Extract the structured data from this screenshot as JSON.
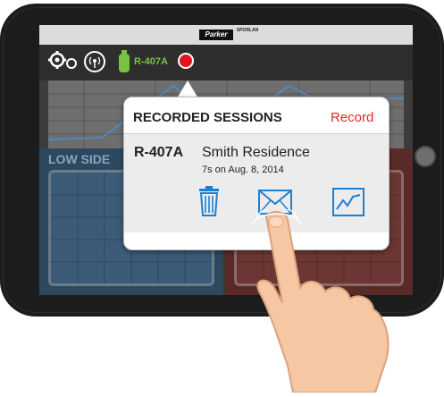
{
  "brand": {
    "logo_text": "Parker",
    "sublogo_text": "SPORLAN"
  },
  "toolbar": {
    "refrigerant": "R-407A",
    "settings_icon": "gear-icon",
    "signal_icon": "wireless-signal-icon",
    "tank_icon": "refrigerant-tank-icon",
    "record_indicator_color": "#e4141c"
  },
  "panels": {
    "low_label": "LOW SIDE"
  },
  "popover": {
    "title": "RECORDED SESSIONS",
    "record_label": "Record",
    "session": {
      "refrigerant": "R-407A",
      "name": "Smith Residence",
      "detail": "7s on Aug. 8, 2014",
      "actions": [
        "trash-icon",
        "email-icon",
        "graph-icon"
      ]
    }
  },
  "colors": {
    "accent_blue": "#1f7fd1",
    "record_red": "#e02a20",
    "refrigerant_green": "#7cc242"
  }
}
